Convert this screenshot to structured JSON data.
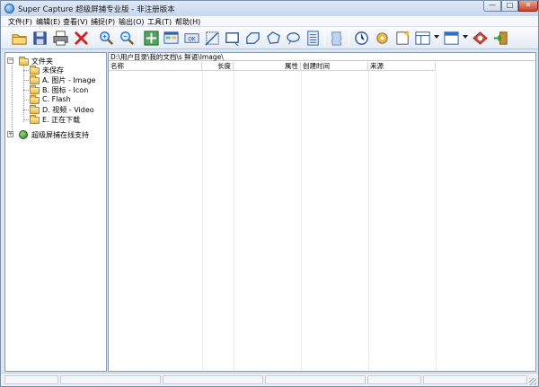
{
  "window": {
    "title": "Super Capture 超级屏捕专业版 - 非注册版本",
    "buttons": {
      "minimize": "—",
      "maximize": "□",
      "close": "✕"
    }
  },
  "menu": [
    "文件(F)",
    "编辑(E)",
    "查看(V)",
    "捕捉(P)",
    "输出(O)",
    "工具(T)",
    "帮助(H)"
  ],
  "toolbar": {
    "icons": [
      "open-folder-icon",
      "save-icon",
      "print-icon",
      "delete-icon",
      "zoom-in-icon",
      "zoom-out-icon",
      "capture-desktop-icon",
      "capture-window-icon",
      "capture-button-icon",
      "capture-region-icon",
      "capture-rectangle-icon",
      "capture-ellipse-icon",
      "capture-round-rect-icon",
      "capture-freehand-icon",
      "capture-scroll-icon",
      "capture-wave-icon",
      "timer-icon",
      "settings-icon",
      "effects-icon",
      "layout-icon",
      "view-options-icon",
      "ie-capture-icon",
      "exit-icon"
    ],
    "colors": {
      "accent": "#2a7fd4",
      "delete": "#d42020",
      "zoom": "#2b6fd1"
    }
  },
  "tree": {
    "root": "文件夹",
    "children": [
      "未保存",
      "A. 图片 - Image",
      "B. 图标 - Icon",
      "C. Flash",
      "D. 视频 - Video",
      "E. 正在下载"
    ],
    "online": "超级屏捕在线支持",
    "expanders": {
      "root": "−",
      "online": "+"
    }
  },
  "file_list": {
    "path": "D:\\用户目录\\我的文档\\s  鲜语\\Image\\",
    "columns": [
      "名称",
      "长度",
      "属性",
      "创建时间",
      "来源"
    ]
  }
}
